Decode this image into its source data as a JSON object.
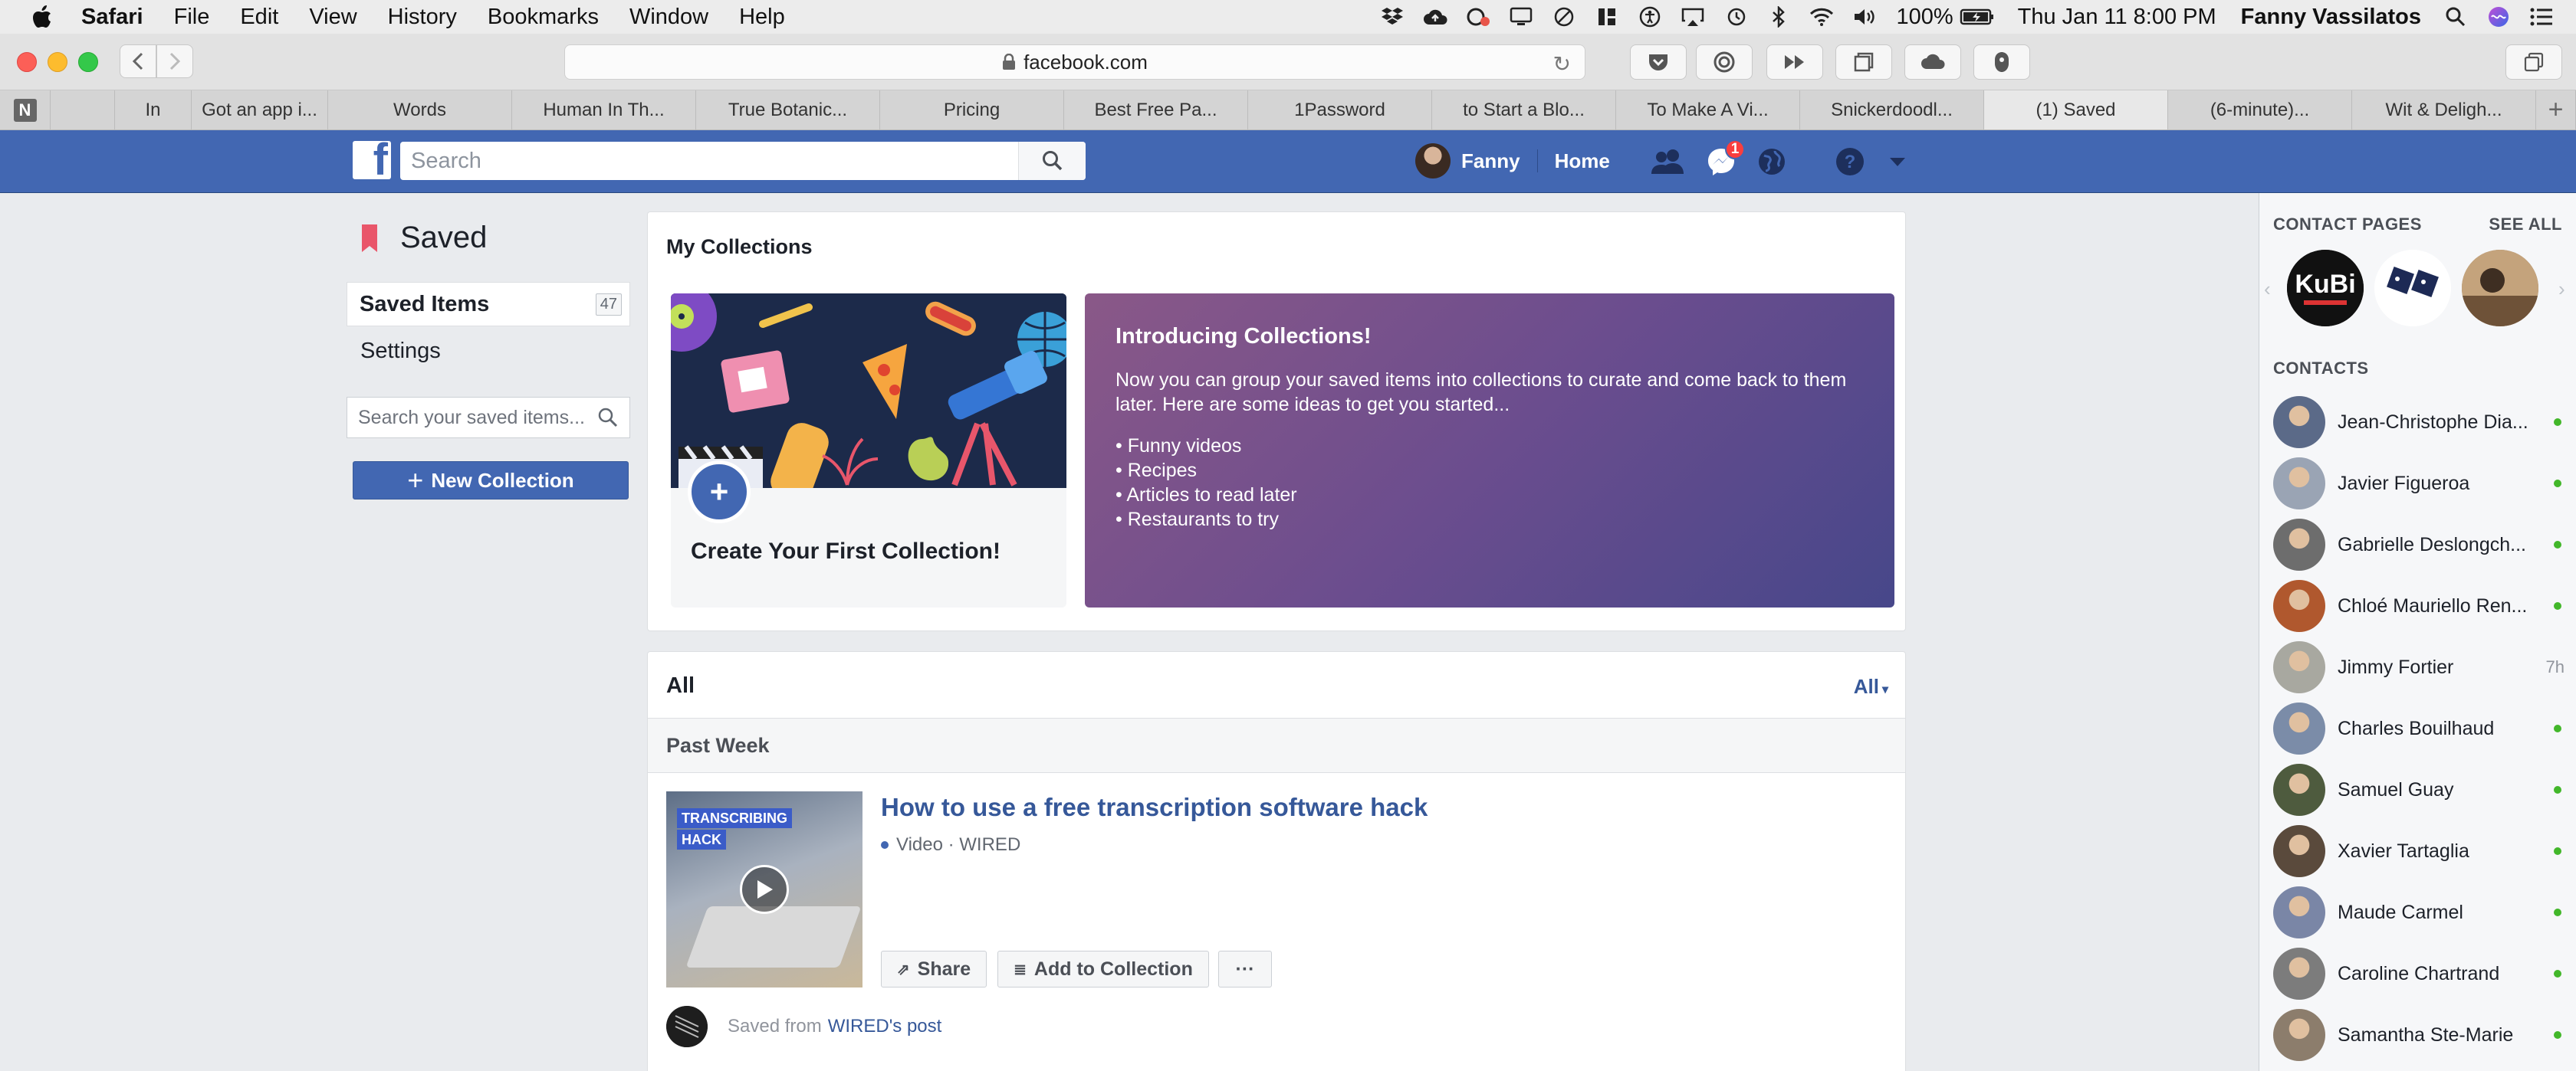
{
  "menubar": {
    "app": "Safari",
    "items": [
      "File",
      "Edit",
      "View",
      "History",
      "Bookmarks",
      "Window",
      "Help"
    ],
    "battery": "100%",
    "datetime": "Thu Jan 11  8:00 PM",
    "user": "Fanny Vassilatos"
  },
  "browser": {
    "url": "facebook.com",
    "tabs": [
      "In",
      "Got an app i...",
      "Words",
      "Human In Th...",
      "True Botanic...",
      "Pricing",
      "Best Free Pa...",
      "1Password",
      "to Start a Blo...",
      "To Make A Vi...",
      "Snickerdoodl...",
      "(1) Saved",
      "(6-minute)...",
      "Wit & Deligh..."
    ],
    "active_tab": "(1) Saved"
  },
  "fb": {
    "search_placeholder": "Search",
    "user_name": "Fanny",
    "home": "Home",
    "messenger_badge": "1",
    "brand_color": "#4267b2"
  },
  "left": {
    "title": "Saved",
    "saved_items": "Saved Items",
    "saved_count": "47",
    "settings": "Settings",
    "search_placeholder": "Search your saved items...",
    "new_collection": "New Collection"
  },
  "collections": {
    "header": "My Collections",
    "create_title": "Create Your First Collection!",
    "intro_title": "Introducing Collections!",
    "intro_body": "Now you can group your saved items into collections to curate and come back to them later. Here are some ideas to get you started...",
    "ideas": [
      "• Funny videos",
      "• Recipes",
      "• Articles to read later",
      "• Restaurants to try"
    ]
  },
  "all": {
    "header": "All",
    "filter": "All",
    "section": "Past Week",
    "item": {
      "thumb_line1": "TRANSCRIBING",
      "thumb_line2": "HACK",
      "title": "How to use a free transcription software hack",
      "meta": "Video · WIRED",
      "share": "Share",
      "add_to_collection": "Add to Collection",
      "more": "···",
      "saved_from": "Saved from",
      "saved_from_link": "WIRED's post"
    }
  },
  "chat": {
    "contact_pages": "CONTACT PAGES",
    "see_all": "SEE ALL",
    "contacts_header": "CONTACTS",
    "contacts": [
      {
        "name": "Jean-Christophe Dia...",
        "status": "online",
        "color": "#5b6a88"
      },
      {
        "name": "Javier Figueroa",
        "status": "online",
        "color": "#9aa4b4"
      },
      {
        "name": "Gabrielle Deslongch...",
        "status": "online",
        "color": "#6d6d6d"
      },
      {
        "name": "Chloé Mauriello Ren...",
        "status": "online",
        "color": "#b0582e"
      },
      {
        "name": "Jimmy Fortier",
        "status": "7h",
        "color": "#a8a8a0"
      },
      {
        "name": "Charles Bouilhaud",
        "status": "online",
        "color": "#7b8ca8"
      },
      {
        "name": "Samuel Guay",
        "status": "online",
        "color": "#4e5b3e"
      },
      {
        "name": "Xavier Tartaglia",
        "status": "online",
        "color": "#5a4a3c"
      },
      {
        "name": "Maude Carmel",
        "status": "online",
        "color": "#7a86a6"
      },
      {
        "name": "Caroline Chartrand",
        "status": "online",
        "color": "#7c7c7c"
      },
      {
        "name": "Samantha Ste-Marie",
        "status": "online",
        "color": "#8c7d6c"
      }
    ]
  }
}
